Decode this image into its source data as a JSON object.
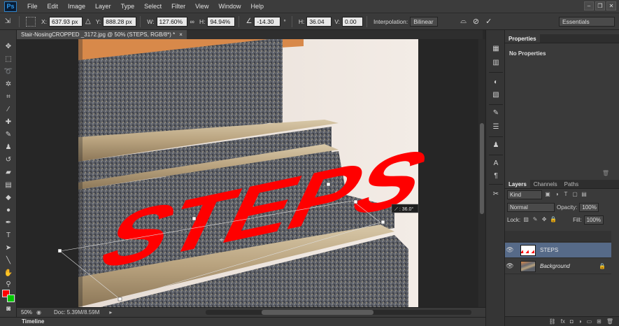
{
  "app": {
    "logo": "Ps"
  },
  "menu": [
    "File",
    "Edit",
    "Image",
    "Layer",
    "Type",
    "Select",
    "Filter",
    "View",
    "Window",
    "Help"
  ],
  "window_controls": {
    "minimize": "–",
    "maximize": "❐",
    "close": "✕"
  },
  "options": {
    "x_label": "X:",
    "x_value": "637.93 px",
    "y_label": "Y:",
    "y_value": "888.28 px",
    "w_label": "W:",
    "w_value": "127.60%",
    "h_label": "H:",
    "h_value": "94.94%",
    "angle_value": "-14.30",
    "angle_unit": "°",
    "hskew_label": "H:",
    "hskew_value": "36.04",
    "vskew_label": "V:",
    "vskew_value": "0.00",
    "interp_label": "Interpolation:",
    "interp_value": "Bilinear",
    "workspace": "Essentials"
  },
  "document": {
    "tab_title": "Stair-NosingCROPPED _3172.jpg @ 50% (STEPS, RGB/8*) *",
    "tab_close": "×",
    "layer_text": "STEPS",
    "skew_readout": "⟋ : 36.0°"
  },
  "status": {
    "zoom": "50%",
    "doc_info": "Doc: 5.39M/8.59M"
  },
  "timeline": {
    "label": "Timeline"
  },
  "properties": {
    "tab": "Properties",
    "empty_text": "No Properties"
  },
  "layers_panel": {
    "tabs": [
      "Layers",
      "Channels",
      "Paths"
    ],
    "filter_kind": "Kind",
    "blend_mode": "Normal",
    "opacity_label": "Opacity:",
    "opacity_value": "100%",
    "lock_label": "Lock:",
    "fill_label": "Fill:",
    "fill_value": "100%",
    "layers": [
      {
        "name": "STEPS",
        "selected": true
      },
      {
        "name": "Background",
        "selected": false
      }
    ]
  },
  "colors": {
    "foreground": "#ff0000",
    "background": "#00c800",
    "accent": "#2d9bef"
  }
}
